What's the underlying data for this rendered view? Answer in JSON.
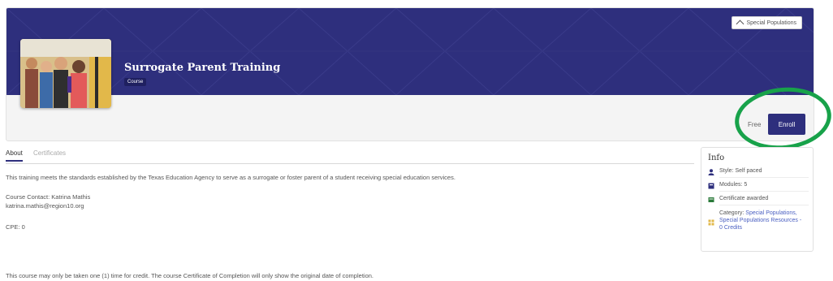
{
  "header": {
    "special_populations_label": "Special Populations",
    "course_title": "Surrogate Parent Training",
    "course_type": "Course",
    "price": "Free",
    "enroll_label": "Enroll"
  },
  "tabs": [
    "About",
    "Certificates"
  ],
  "about": {
    "description": "This training meets the standards established by the Texas Education Agency to serve as a surrogate or foster parent of a student receiving special education services.",
    "contact_line": "Course Contact: Katrina Mathis",
    "contact_email": "katrina.mathis@region10.org",
    "cpe": "CPE: 0",
    "footer_note": "This course may only be taken one (1) time for credit. The course Certificate of Completion will only show the original date of completion."
  },
  "info": {
    "title": "Info",
    "style": "Style: Self paced",
    "modules": "Modules: 5",
    "certificate": "Certificate awarded",
    "category_prefix": "Category: ",
    "category_links": "Special Populations, Special Populations Resources - 0 Credits"
  },
  "colors": {
    "brand": "#2e2f7d",
    "highlight_ring": "#18a24a",
    "link": "#4a5fc1"
  },
  "icons": [
    "chevron-up-icon",
    "person-icon",
    "module-icon",
    "certificate-icon",
    "category-icon"
  ]
}
